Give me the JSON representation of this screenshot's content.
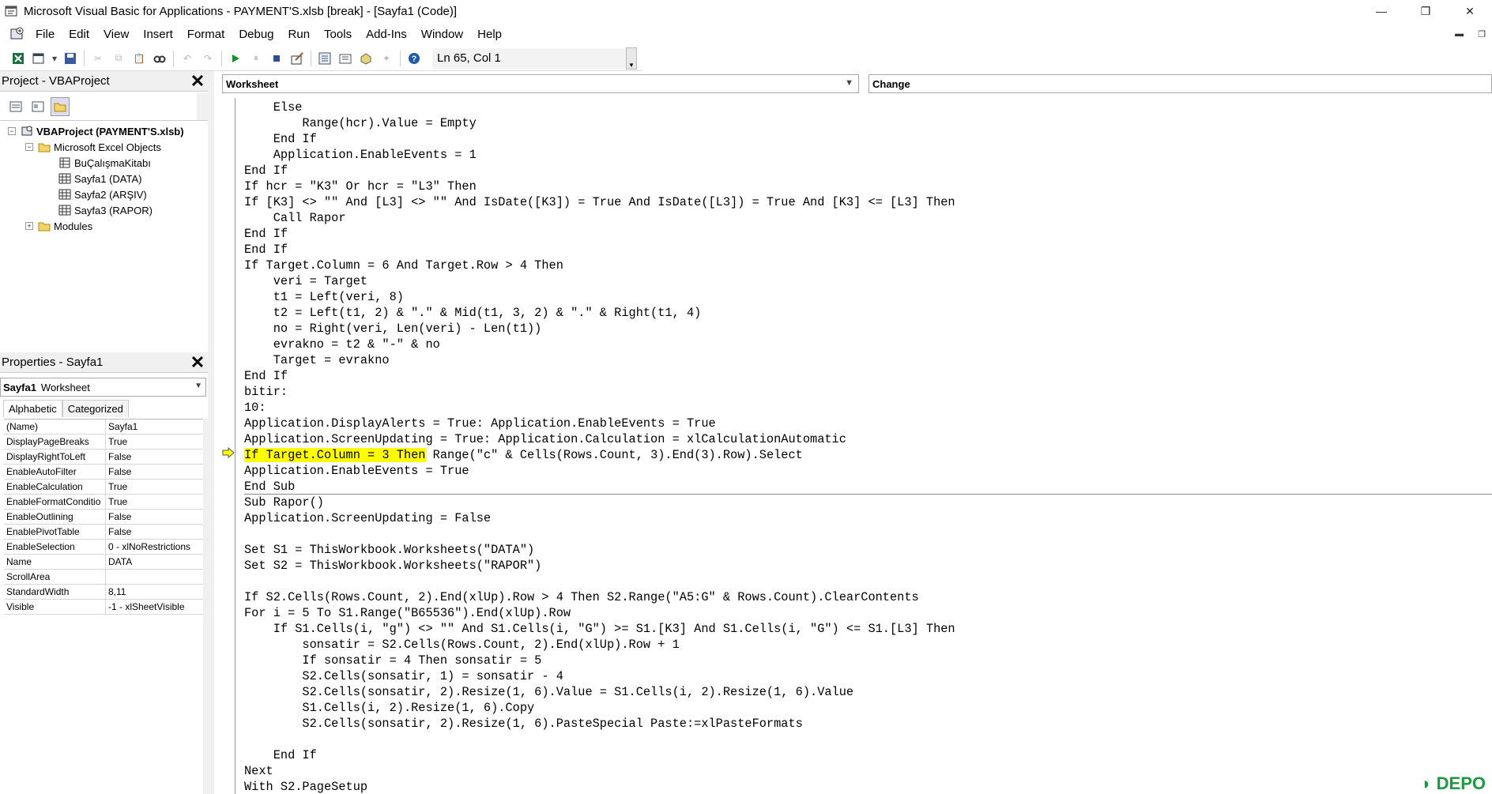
{
  "window": {
    "title": "Microsoft Visual Basic for Applications - PAYMENT'S.xlsb [break] - [Sayfa1 (Code)]",
    "minimize": "—",
    "restore": "❐",
    "close": "✕"
  },
  "menu": [
    "File",
    "Edit",
    "View",
    "Insert",
    "Format",
    "Debug",
    "Run",
    "Tools",
    "Add-Ins",
    "Window",
    "Help"
  ],
  "toolbar": {
    "position": "Ln 65, Col 1"
  },
  "project": {
    "title": "Project - VBAProject",
    "root": "VBAProject (PAYMENT'S.xlsb)",
    "folder_objects": "Microsoft Excel Objects",
    "items": [
      "BuÇalışmaKitabı",
      "Sayfa1 (DATA)",
      "Sayfa2 (ARŞIV)",
      "Sayfa3 (RAPOR)"
    ],
    "folder_modules": "Modules"
  },
  "properties": {
    "title": "Properties - Sayfa1",
    "object_name": "Sayfa1",
    "object_type": "Worksheet",
    "tab_alphabetic": "Alphabetic",
    "tab_categorized": "Categorized",
    "rows": [
      {
        "name": "(Name)",
        "value": "Sayfa1"
      },
      {
        "name": "DisplayPageBreaks",
        "value": "True"
      },
      {
        "name": "DisplayRightToLeft",
        "value": "False"
      },
      {
        "name": "EnableAutoFilter",
        "value": "False"
      },
      {
        "name": "EnableCalculation",
        "value": "True"
      },
      {
        "name": "EnableFormatConditio",
        "value": "True"
      },
      {
        "name": "EnableOutlining",
        "value": "False"
      },
      {
        "name": "EnablePivotTable",
        "value": "False"
      },
      {
        "name": "EnableSelection",
        "value": "0 - xlNoRestrictions"
      },
      {
        "name": "Name",
        "value": "DATA"
      },
      {
        "name": "ScrollArea",
        "value": ""
      },
      {
        "name": "StandardWidth",
        "value": "8,11"
      },
      {
        "name": "Visible",
        "value": "-1 - xlSheetVisible"
      }
    ]
  },
  "code": {
    "object_combo": "Worksheet",
    "proc_combo": "Change",
    "lines": [
      "    Else",
      "        Range(hcr).Value = Empty",
      "    End If",
      "    Application.EnableEvents = 1",
      "End If",
      "If hcr = \"K3\" Or hcr = \"L3\" Then",
      "If [K3] <> \"\" And [L3] <> \"\" And IsDate([K3]) = True And IsDate([L3]) = True And [K3] <= [L3] Then",
      "    Call Rapor",
      "End If",
      "End If",
      "If Target.Column = 6 And Target.Row > 4 Then",
      "    veri = Target",
      "    t1 = Left(veri, 8)",
      "    t2 = Left(t1, 2) & \".\" & Mid(t1, 3, 2) & \".\" & Right(t1, 4)",
      "    no = Right(veri, Len(veri) - Len(t1))",
      "    evrakno = t2 & \"-\" & no",
      "    Target = evrakno",
      "End If",
      "bitir:",
      "10:",
      "Application.DisplayAlerts = True: Application.EnableEvents = True",
      "Application.ScreenUpdating = True: Application.Calculation = xlCalculationAutomatic",
      "Application.EnableEvents = True",
      "End Sub",
      "Sub Rapor()",
      "Application.ScreenUpdating = False",
      "",
      "Set S1 = ThisWorkbook.Worksheets(\"DATA\")",
      "Set S2 = ThisWorkbook.Worksheets(\"RAPOR\")",
      "",
      "If S2.Cells(Rows.Count, 2).End(xlUp).Row > 4 Then S2.Range(\"A5:G\" & Rows.Count).ClearContents",
      "For i = 5 To S1.Range(\"B65536\").End(xlUp).Row",
      "    If S1.Cells(i, \"g\") <> \"\" And S1.Cells(i, \"G\") >= S1.[K3] And S1.Cells(i, \"G\") <= S1.[L3] Then",
      "        sonsatir = S2.Cells(Rows.Count, 2).End(xlUp).Row + 1",
      "        If sonsatir = 4 Then sonsatir = 5",
      "        S2.Cells(sonsatir, 1) = sonsatir - 4",
      "        S2.Cells(sonsatir, 2).Resize(1, 6).Value = S1.Cells(i, 2).Resize(1, 6).Value",
      "        S1.Cells(i, 2).Resize(1, 6).Copy",
      "        S2.Cells(sonsatir, 2).Resize(1, 6).PasteSpecial Paste:=xlPasteFormats",
      "",
      "    End If",
      "Next",
      "With S2.PageSetup"
    ],
    "highlight_part": "If Target.Column = 3 Then",
    "highlight_rest": " Range(\"c\" & Cells(Rows.Count, 3).End(3).Row).Select"
  },
  "watermark": "DEPO"
}
